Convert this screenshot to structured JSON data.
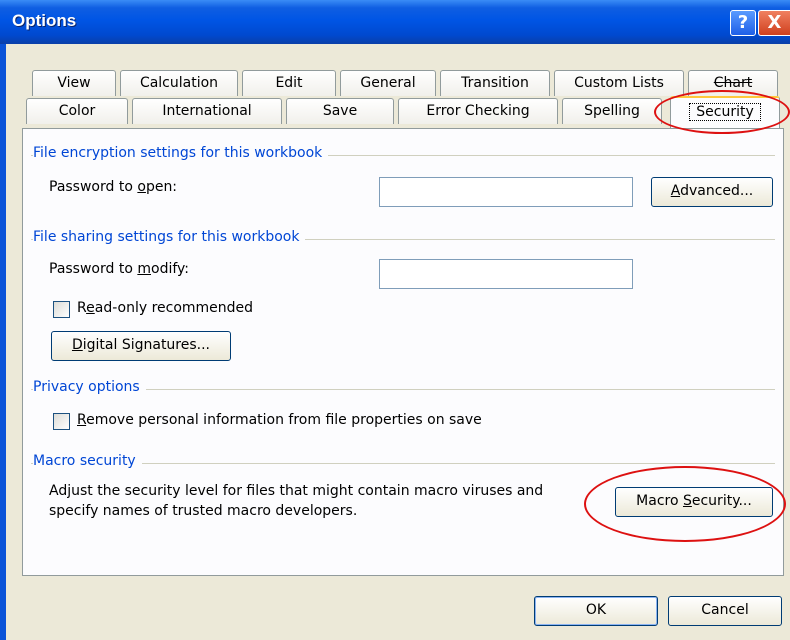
{
  "window": {
    "title": "Options",
    "help_icon": "?",
    "close_icon": "X"
  },
  "tabs_row1": [
    "View",
    "Calculation",
    "Edit",
    "General",
    "Transition",
    "Custom Lists",
    "Chart"
  ],
  "tabs_row2": [
    "Color",
    "International",
    "Save",
    "Error Checking",
    "Spelling",
    "Security"
  ],
  "selected_tab": "Security",
  "encryption": {
    "group_label": "File encryption settings for this workbook",
    "password_open_pre": "Password to ",
    "password_open_ul": "o",
    "password_open_post": "pen:",
    "password_open_value": "",
    "advanced_ul": "A",
    "advanced_post": "dvanced..."
  },
  "sharing": {
    "group_label": "File sharing settings for this workbook",
    "password_modify_pre": "Password to ",
    "password_modify_ul": "m",
    "password_modify_post": "odify:",
    "password_modify_value": "",
    "readonly_pre": "R",
    "readonly_ul": "e",
    "readonly_post": "ad-only recommended",
    "readonly_checked": false,
    "digsig_ul": "D",
    "digsig_post": "igital Signatures..."
  },
  "privacy": {
    "group_label": "Privacy options",
    "remove_ul": "R",
    "remove_post": "emove personal information from file properties on save",
    "remove_checked": false
  },
  "macro": {
    "group_label": "Macro security",
    "desc_line1": "Adjust the security level for files that might contain macro viruses and",
    "desc_line2": "specify names of trusted macro developers.",
    "button_pre": "Macro ",
    "button_ul": "S",
    "button_post": "ecurity..."
  },
  "footer": {
    "ok": "OK",
    "cancel": "Cancel"
  },
  "annotation_color": "#dd1111"
}
